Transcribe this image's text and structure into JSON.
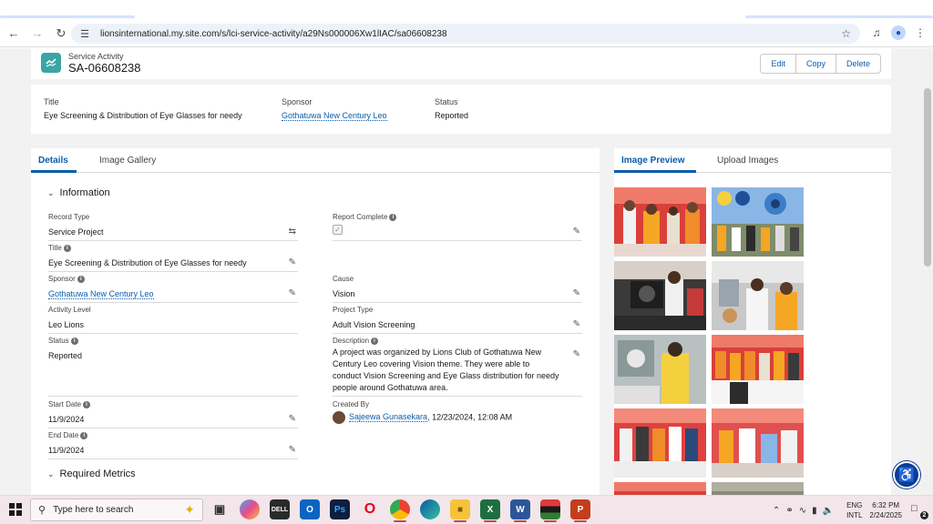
{
  "browser": {
    "url": "lionsinternational.my.site.com/s/lci-service-activity/a29Ns000006Xw1lIAC/sa06608238"
  },
  "header": {
    "object_label": "Service Activity",
    "record_name": "SA-06608238",
    "buttons": {
      "edit": "Edit",
      "copy": "Copy",
      "delete": "Delete"
    }
  },
  "highlights": {
    "title_label": "Title",
    "title_value": "Eye Screening & Distribution of Eye Glasses for needy",
    "sponsor_label": "Sponsor",
    "sponsor_value": "Gothatuwa New Century Leo",
    "status_label": "Status",
    "status_value": "Reported"
  },
  "details": {
    "tabs": {
      "details": "Details",
      "gallery": "Image Gallery"
    },
    "section_information": "Information",
    "section_required_metrics": "Required Metrics",
    "fields": {
      "record_type": {
        "label": "Record Type",
        "value": "Service Project"
      },
      "report_complete": {
        "label": "Report Complete"
      },
      "title": {
        "label": "Title",
        "value": "Eye Screening & Distribution of Eye Glasses for needy"
      },
      "sponsor": {
        "label": "Sponsor",
        "value": "Gothatuwa New Century Leo"
      },
      "cause": {
        "label": "Cause",
        "value": "Vision"
      },
      "activity_level": {
        "label": "Activity Level",
        "value": "Leo Lions"
      },
      "project_type": {
        "label": "Project Type",
        "value": "Adult Vision Screening"
      },
      "status": {
        "label": "Status",
        "value": "Reported"
      },
      "description": {
        "label": "Description",
        "value": "A project was organized by Lions Club of Gothatuwa New Century Leo covering Vision theme. They were able to conduct Vision Screening and Eye Glass distribution for needy people around Gothatuwa area."
      },
      "start_date": {
        "label": "Start Date",
        "value": "11/9/2024"
      },
      "created_by": {
        "label": "Created By",
        "user": "Sajeewa Gunasekara",
        "datetime": ", 12/23/2024, 12:08 AM"
      },
      "end_date": {
        "label": "End Date",
        "value": "11/9/2024"
      }
    }
  },
  "preview": {
    "tabs": {
      "preview": "Image Preview",
      "upload": "Upload Images"
    }
  },
  "taskbar": {
    "search_placeholder": "Type here to search",
    "lang_1": "ENG",
    "lang_2": "INTL",
    "time": "6:32 PM",
    "date": "2/24/2025",
    "notif_count": "2"
  },
  "colors": {
    "brand_blue": "#0b5cab",
    "record_icon": "#3ba5a5",
    "page_bg": "#f3f2f2"
  }
}
